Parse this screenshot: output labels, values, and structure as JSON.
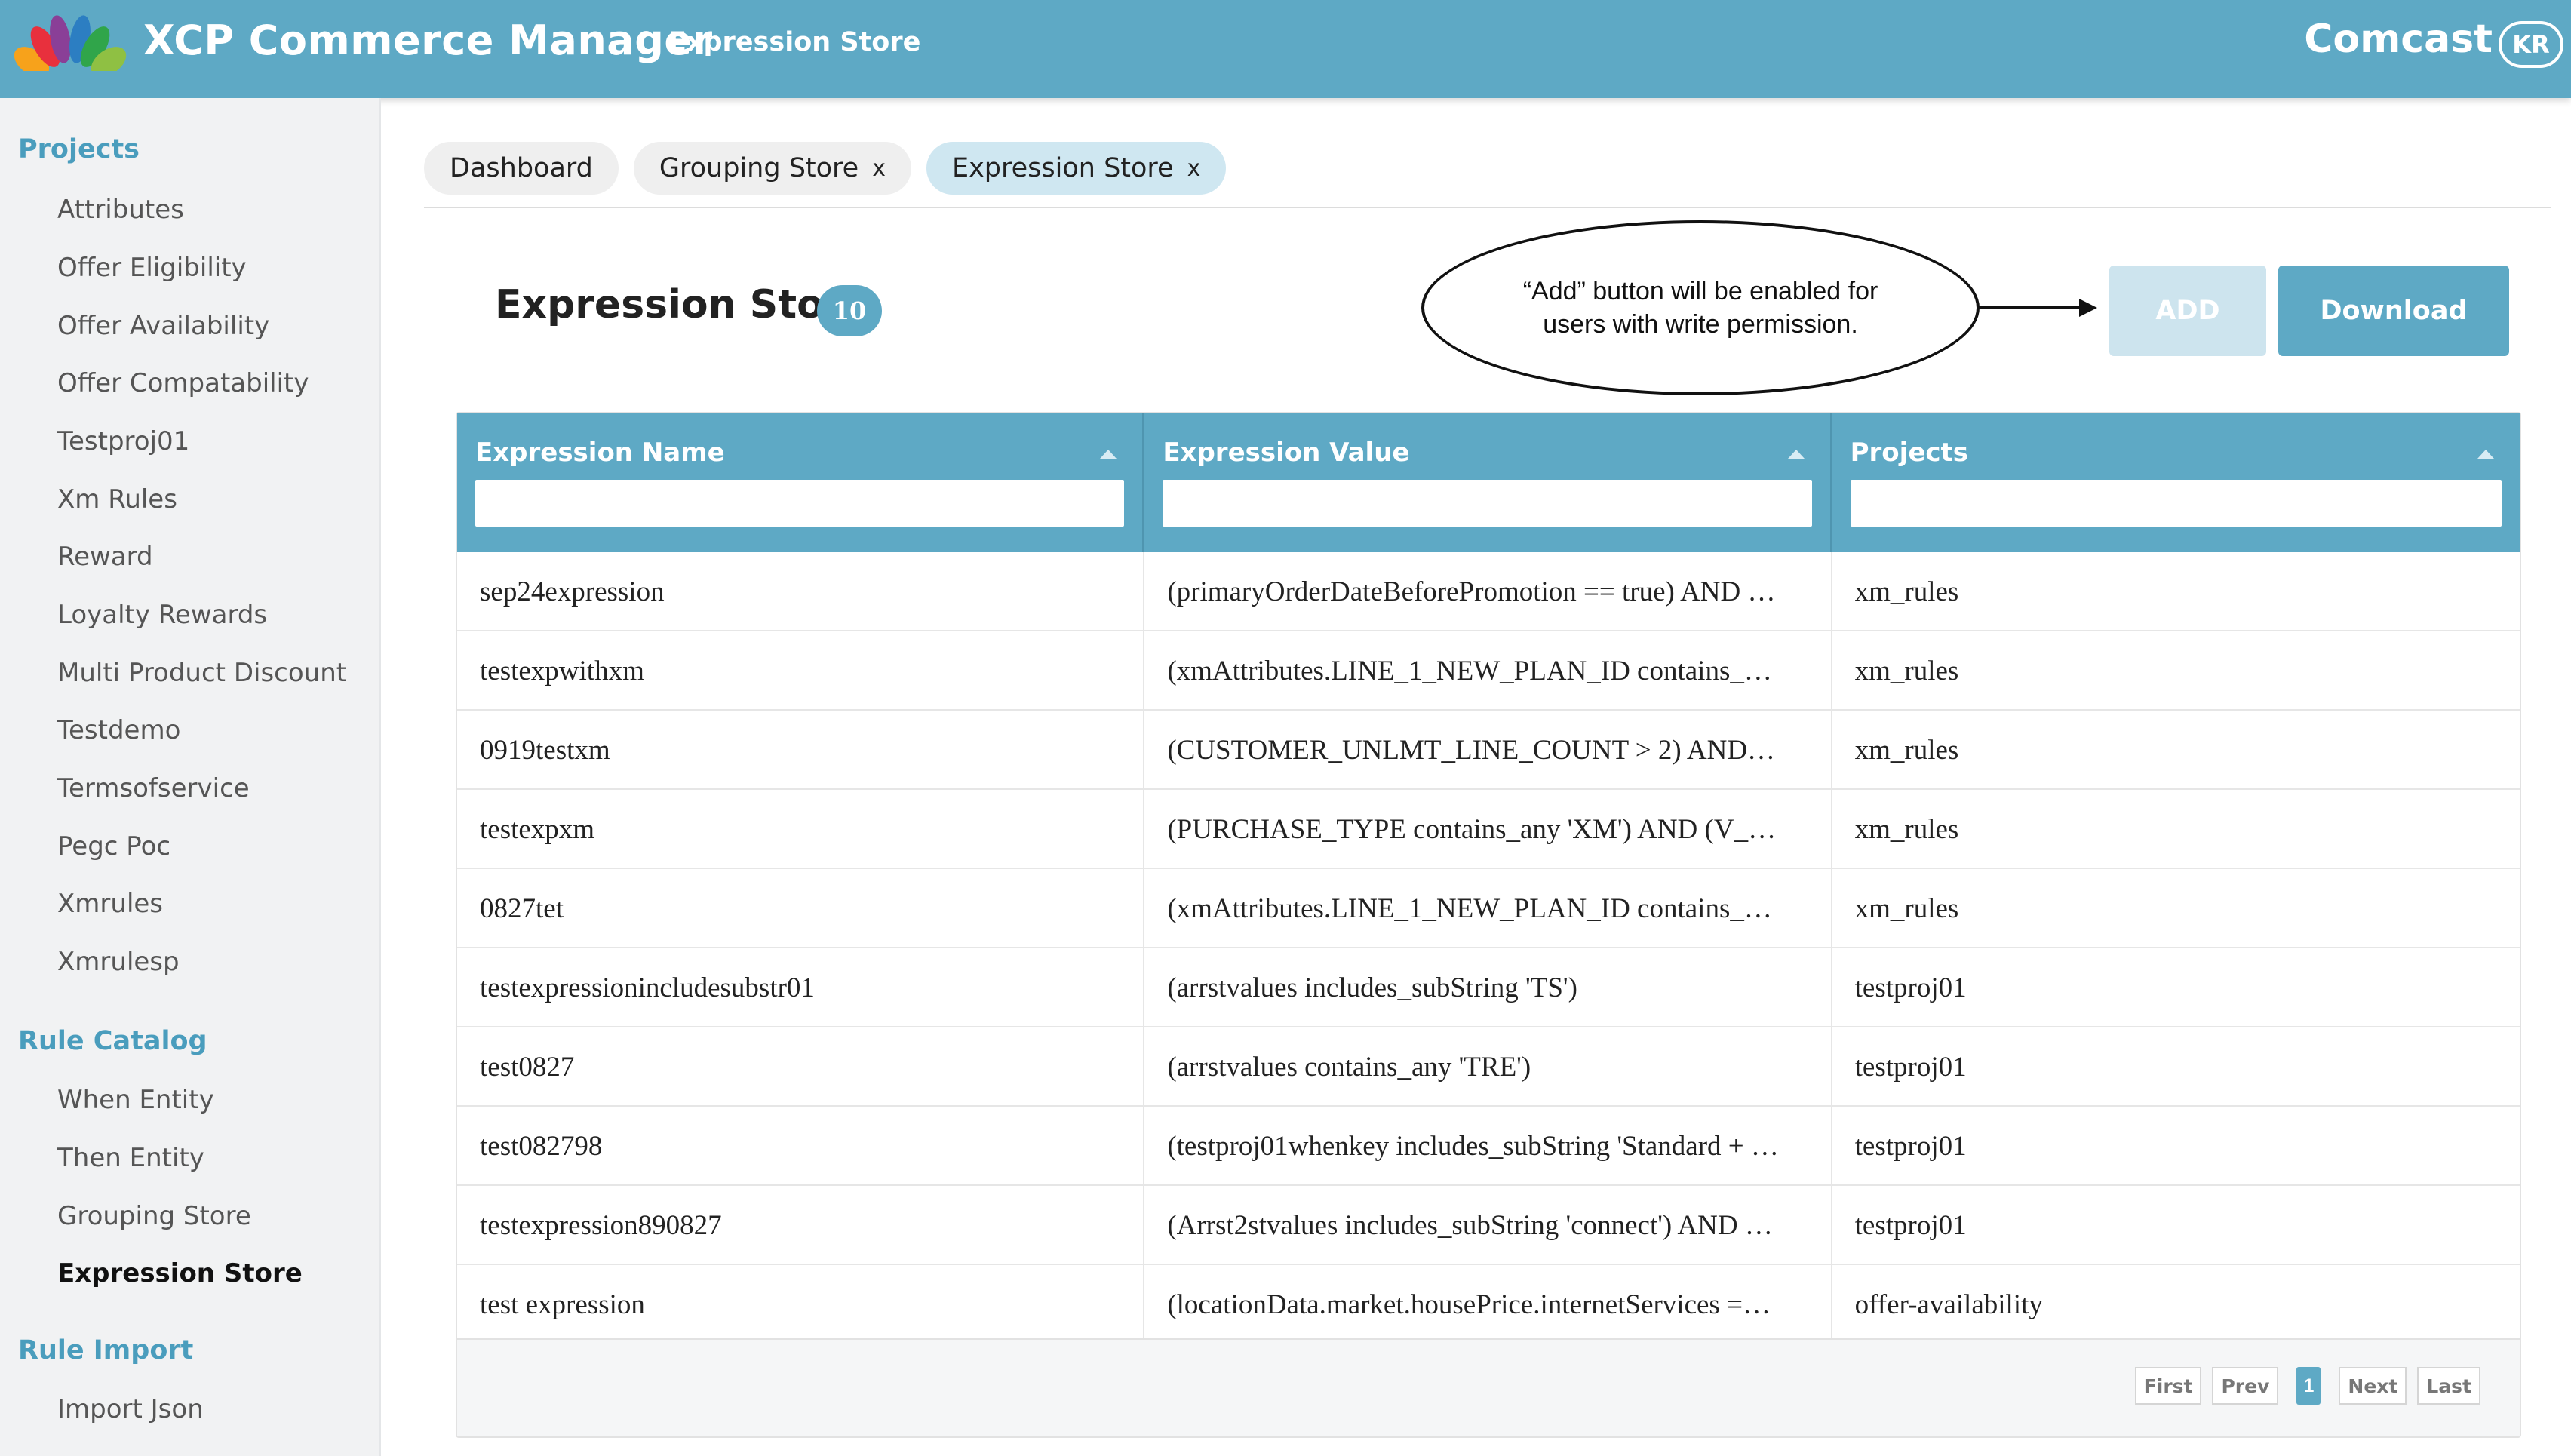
{
  "header": {
    "app_title": "XCP Commerce Manager",
    "page_label": "Expression Store",
    "brand": "Comcast",
    "user_initials": "KR",
    "logo_icon": "nbc-peacock-logo"
  },
  "sidebar": {
    "sections": [
      {
        "title": "Projects",
        "items": [
          {
            "label": "Attributes"
          },
          {
            "label": "Offer Eligibility"
          },
          {
            "label": "Offer Availability"
          },
          {
            "label": "Offer Compatability"
          },
          {
            "label": "Testproj01"
          },
          {
            "label": "Xm Rules"
          },
          {
            "label": "Reward"
          },
          {
            "label": "Loyalty Rewards"
          },
          {
            "label": "Multi Product Discount"
          },
          {
            "label": "Testdemo"
          },
          {
            "label": "Termsofservice"
          },
          {
            "label": "Pegc Poc"
          },
          {
            "label": "Xmrules"
          },
          {
            "label": "Xmrulesp"
          }
        ]
      },
      {
        "title": "Rule Catalog",
        "items": [
          {
            "label": "When Entity"
          },
          {
            "label": "Then Entity"
          },
          {
            "label": "Grouping Store"
          },
          {
            "label": "Expression Store",
            "active": true
          }
        ]
      },
      {
        "title": "Rule Import",
        "items": [
          {
            "label": "Import Json"
          }
        ]
      }
    ]
  },
  "tabs": [
    {
      "label": "Dashboard",
      "closable": false,
      "active": false
    },
    {
      "label": "Grouping Store",
      "closable": true,
      "close": "x",
      "active": false
    },
    {
      "label": "Expression Store",
      "closable": true,
      "close": "x",
      "active": true
    }
  ],
  "page": {
    "title": "Expression Store",
    "count": "10"
  },
  "annotation": {
    "text": "“Add” button will be enabled for users with write permission."
  },
  "buttons": {
    "add": "ADD",
    "download": "Download"
  },
  "table": {
    "columns": [
      {
        "label": "Expression Name",
        "filter_value": ""
      },
      {
        "label": "Expression Value",
        "filter_value": ""
      },
      {
        "label": "Projects",
        "filter_value": ""
      }
    ],
    "rows": [
      [
        "sep24expression",
        "(primaryOrderDateBeforePromotion == true) AND …",
        "xm_rules"
      ],
      [
        "testexpwithxm",
        "(xmAttributes.LINE_1_NEW_PLAN_ID contains_…",
        "xm_rules"
      ],
      [
        "0919testxm",
        "(CUSTOMER_UNLMT_LINE_COUNT > 2) AND…",
        "xm_rules"
      ],
      [
        "testexpxm",
        "(PURCHASE_TYPE contains_any 'XM') AND (V_…",
        "xm_rules"
      ],
      [
        "0827tet",
        "(xmAttributes.LINE_1_NEW_PLAN_ID contains_…",
        "xm_rules"
      ],
      [
        "testexpressionincludesubstr01",
        "(arrstvalues includes_subString 'TS')",
        "testproj01"
      ],
      [
        "test0827",
        "(arrstvalues contains_any 'TRE')",
        "testproj01"
      ],
      [
        "test082798",
        "(testproj01whenkey includes_subString 'Standard + …",
        "testproj01"
      ],
      [
        "testexpression890827",
        "(Arrst2stvalues includes_subString 'connect') AND …",
        "testproj01"
      ],
      [
        "test expression",
        "(locationData.market.housePrice.internetServices =…",
        "offer-availability"
      ]
    ]
  },
  "pagination": {
    "first": "First",
    "prev": "Prev",
    "current": "1",
    "next": "Next",
    "last": "Last"
  },
  "colors": {
    "header_bg": "#5ea9c5",
    "accent": "#4a9dbd",
    "add_disabled": "#cde4ee"
  }
}
